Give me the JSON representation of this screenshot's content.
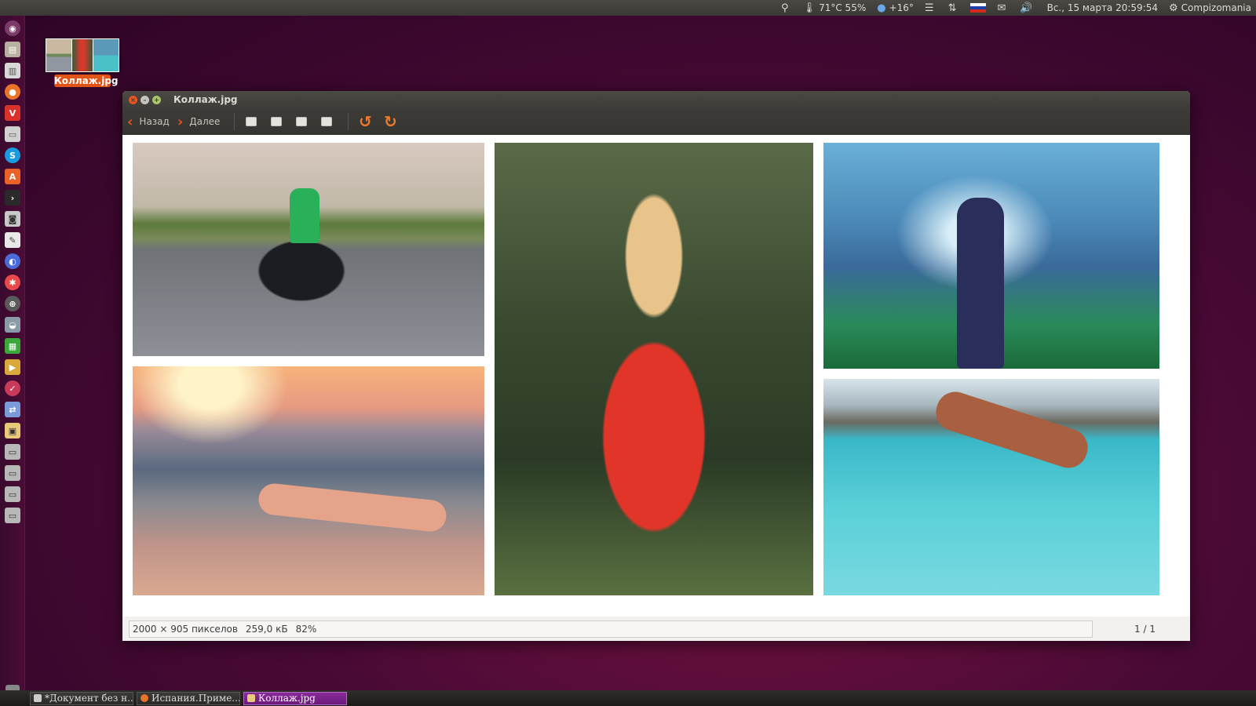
{
  "top_panel": {
    "temperature": "71°C 55%",
    "weather": "+16°",
    "datetime": "Вс., 15 марта 20:59:54",
    "session_user": "Compizomania",
    "flag_colors": [
      "#ffffff",
      "#1c3fa8",
      "#d52b1e"
    ]
  },
  "desktop": {
    "icon_label": "Коллаж.jpg"
  },
  "window": {
    "title": "Коллаж.jpg",
    "toolbar": {
      "back_label": "Назад",
      "forward_label": "Далее"
    },
    "status": {
      "dimensions": "2000 × 905 пикселов",
      "file_size": "259,0 кБ",
      "zoom": "82%",
      "page_count": "1 / 1"
    },
    "accent_color": "#e95420"
  },
  "taskbar": {
    "tasks": [
      {
        "label": "*Документ без н..."
      },
      {
        "label": "Испания.Приме..."
      },
      {
        "label": "Коллаж.jpg"
      }
    ]
  },
  "launcher": {
    "icons": [
      "dash-home-icon",
      "files-icon",
      "document-icon",
      "firefox-icon",
      "vivaldi-icon",
      "folder-icon",
      "skype-icon",
      "software-center-icon",
      "terminal-icon",
      "screenshot-icon",
      "text-editor-icon",
      "settings-icon",
      "update-icon",
      "system-icon",
      "drive-icon",
      "spreadsheet-icon",
      "media-icon",
      "checker-icon",
      "transfer-icon",
      "image-viewer-icon",
      "disk-icon",
      "disk-icon",
      "disk-icon",
      "disk-icon"
    ]
  }
}
